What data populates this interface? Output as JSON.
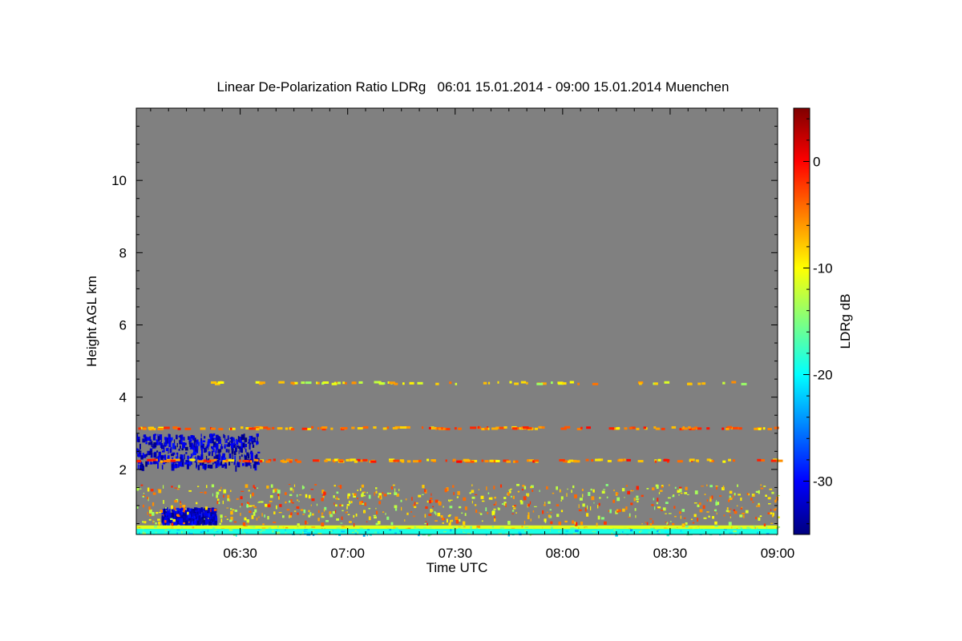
{
  "chart_data": {
    "type": "heatmap",
    "title": "Linear De-Polarization Ratio LDRg   06:01 15.01.2014 - 09:00 15.01.2014 Muenchen",
    "xlabel": "Time UTC",
    "ylabel": "Height AGL km",
    "colorbar_label": "LDRg dB",
    "x_range": [
      "06:01",
      "09:00"
    ],
    "x_ticks": [
      "06:30",
      "07:00",
      "07:30",
      "08:00",
      "08:30",
      "09:00"
    ],
    "ylim": [
      0.2,
      12.0
    ],
    "y_ticks": [
      "2",
      "4",
      "6",
      "8",
      "10"
    ],
    "colorbar_range": [
      -35,
      5
    ],
    "colorbar_ticks": [
      "0",
      "-10",
      "-20",
      "-30"
    ],
    "colormap": "jet",
    "background_color": "#808080",
    "features": [
      {
        "description": "blue patches (depolarizing layer)",
        "time": [
          "06:01",
          "06:35"
        ],
        "height_km": [
          2.1,
          3.0
        ],
        "ldr_db": -32
      },
      {
        "description": "blue patches near ground",
        "time": [
          "06:08",
          "06:23"
        ],
        "height_km": [
          0.55,
          0.95
        ],
        "ldr_db": -32
      },
      {
        "description": "yellow/orange band",
        "time": [
          "06:01",
          "09:00"
        ],
        "height_km": [
          0.35,
          0.45
        ],
        "ldr_db": -11
      },
      {
        "description": "cyan/green band",
        "time": [
          "06:01",
          "09:00"
        ],
        "height_km": [
          0.2,
          0.35
        ],
        "ldr_db": -19
      },
      {
        "description": "scattered orange/yellow returns",
        "time": [
          "06:01",
          "09:00"
        ],
        "height_km": [
          0.5,
          1.6
        ],
        "ldr_db": -8
      },
      {
        "description": "thin orange/red layer",
        "time": [
          "06:01",
          "09:00"
        ],
        "height_km": [
          3.1,
          3.2
        ],
        "ldr_db": -5
      },
      {
        "description": "thin orange layer",
        "time": [
          "06:01",
          "09:00"
        ],
        "height_km": [
          2.2,
          2.3
        ],
        "ldr_db": -5
      },
      {
        "description": "sparse yellow layer",
        "time": [
          "06:20",
          "08:50"
        ],
        "height_km": [
          4.35,
          4.45
        ],
        "ldr_db": -9
      }
    ]
  }
}
